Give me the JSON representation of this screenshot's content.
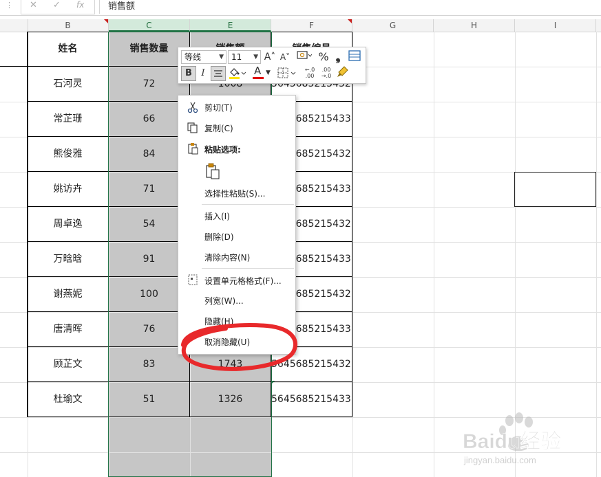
{
  "formula_bar": {
    "menu_dots": "⋮",
    "cancel_glyph": "✕",
    "confirm_glyph": "✓",
    "fx_glyph": "fx",
    "content": "销售额"
  },
  "columns": [
    "B",
    "C",
    "E",
    "F",
    "G",
    "H",
    "I"
  ],
  "table": {
    "headers": [
      "姓名",
      "销售数量",
      "销售额",
      "销售编号"
    ],
    "rows": [
      {
        "name": "石河灵",
        "qty": "72",
        "sales": "1008",
        "code": "5645685215432"
      },
      {
        "name": "常芷珊",
        "qty": "66",
        "sales": "",
        "code": "5645685215433"
      },
      {
        "name": "熊俊雅",
        "qty": "84",
        "sales": "",
        "code": "5645685215432"
      },
      {
        "name": "姚访卉",
        "qty": "71",
        "sales": "",
        "code": "5645685215433"
      },
      {
        "name": "周卓逸",
        "qty": "54",
        "sales": "",
        "code": "5645685215432"
      },
      {
        "name": "万晗晗",
        "qty": "91",
        "sales": "",
        "code": "5645685215433"
      },
      {
        "name": "谢燕妮",
        "qty": "100",
        "sales": "",
        "code": "5645685215432"
      },
      {
        "name": "唐清晖",
        "qty": "76",
        "sales": "",
        "code": "5645685215433"
      },
      {
        "name": "顾芷文",
        "qty": "83",
        "sales": "1743",
        "code": "5645685215432"
      },
      {
        "name": "杜瑜文",
        "qty": "51",
        "sales": "1326",
        "code": "5645685215433"
      }
    ]
  },
  "mini_toolbar": {
    "font_name": "等线",
    "font_size": "11",
    "grow_font": "A˄",
    "shrink_font": "A˅",
    "percent": "%",
    "comma": "❟",
    "bold": "B",
    "italic": "I",
    "font_color_letter": "A",
    "dec_increase": "←.0 .00",
    "dec_decrease": ".00 →.0"
  },
  "context_menu": {
    "items": [
      {
        "label": "剪切(T)",
        "icon": "scissors-icon"
      },
      {
        "label": "复制(C)",
        "icon": "copy-icon"
      },
      {
        "label": "粘贴选项:",
        "icon": "clipboard-icon"
      },
      {
        "label": "选择性粘贴(S)...",
        "icon": ""
      },
      {
        "label": "插入(I)",
        "icon": ""
      },
      {
        "label": "删除(D)",
        "icon": ""
      },
      {
        "label": "清除内容(N)",
        "icon": ""
      },
      {
        "label": "设置单元格格式(F)...",
        "icon": "format-cells-icon"
      },
      {
        "label": "列宽(W)...",
        "icon": ""
      },
      {
        "label": "隐藏(H)",
        "icon": ""
      },
      {
        "label": "取消隐藏(U)",
        "icon": ""
      }
    ]
  },
  "watermark": {
    "brand": "Baidu经验",
    "site": "jingyan.baidu.com"
  },
  "colors": {
    "selected_column": "#c6c6c6",
    "selection_border": "#217346",
    "annotation": "#e8292b",
    "comment_marker": "#c9211e",
    "font_color_bar": "#e00000",
    "fill_color_bar": "#ffe600"
  }
}
